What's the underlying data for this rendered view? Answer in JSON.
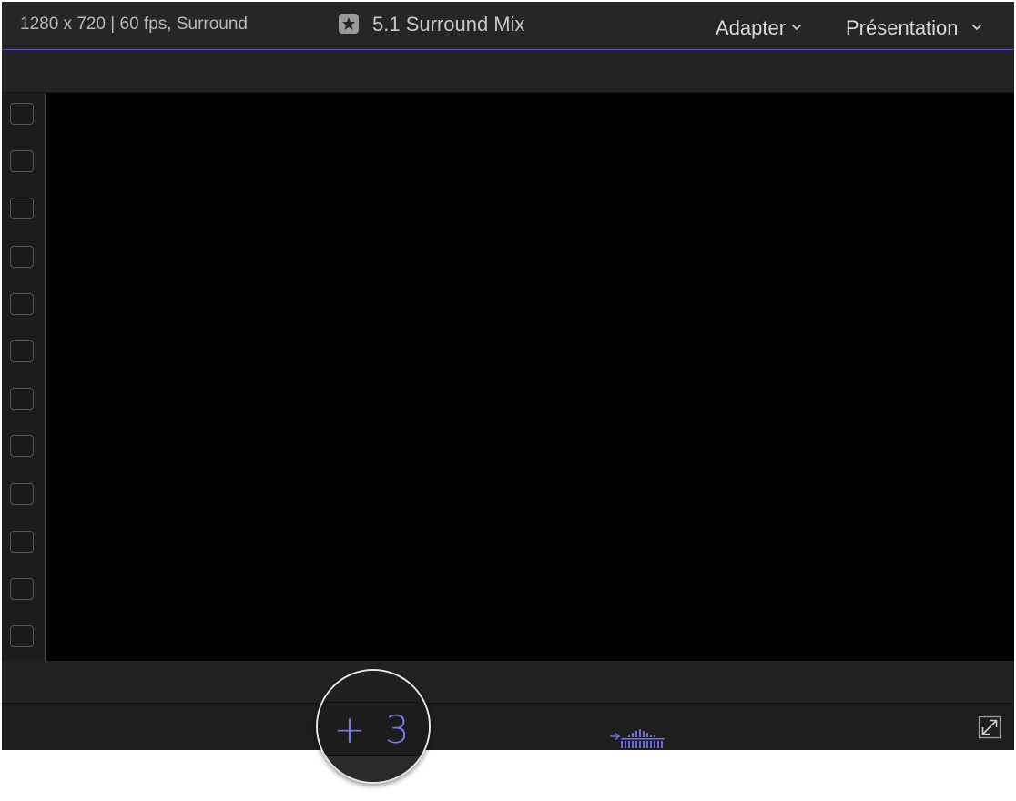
{
  "titlebar": {
    "format": "1280 x 720 | 60 fps, Surround",
    "project_icon": "star-icon",
    "project_title": "5.1 Surround Mix",
    "menus": [
      {
        "label": "Adapter",
        "icon": "chevron-down-icon"
      },
      {
        "label": "Présentation",
        "icon": "chevron-down-icon"
      }
    ]
  },
  "roles": {
    "checkbox_count": 12
  },
  "bottom_bar": {
    "lane_counter": "+ 3",
    "meter_icon": "audio-meter-icon",
    "fullscreen_icon": "fullscreen-icon"
  },
  "colors": {
    "accent": "#7b78ef",
    "viewer_bg": "#000000",
    "chrome_bg": "#1f1f1f"
  }
}
